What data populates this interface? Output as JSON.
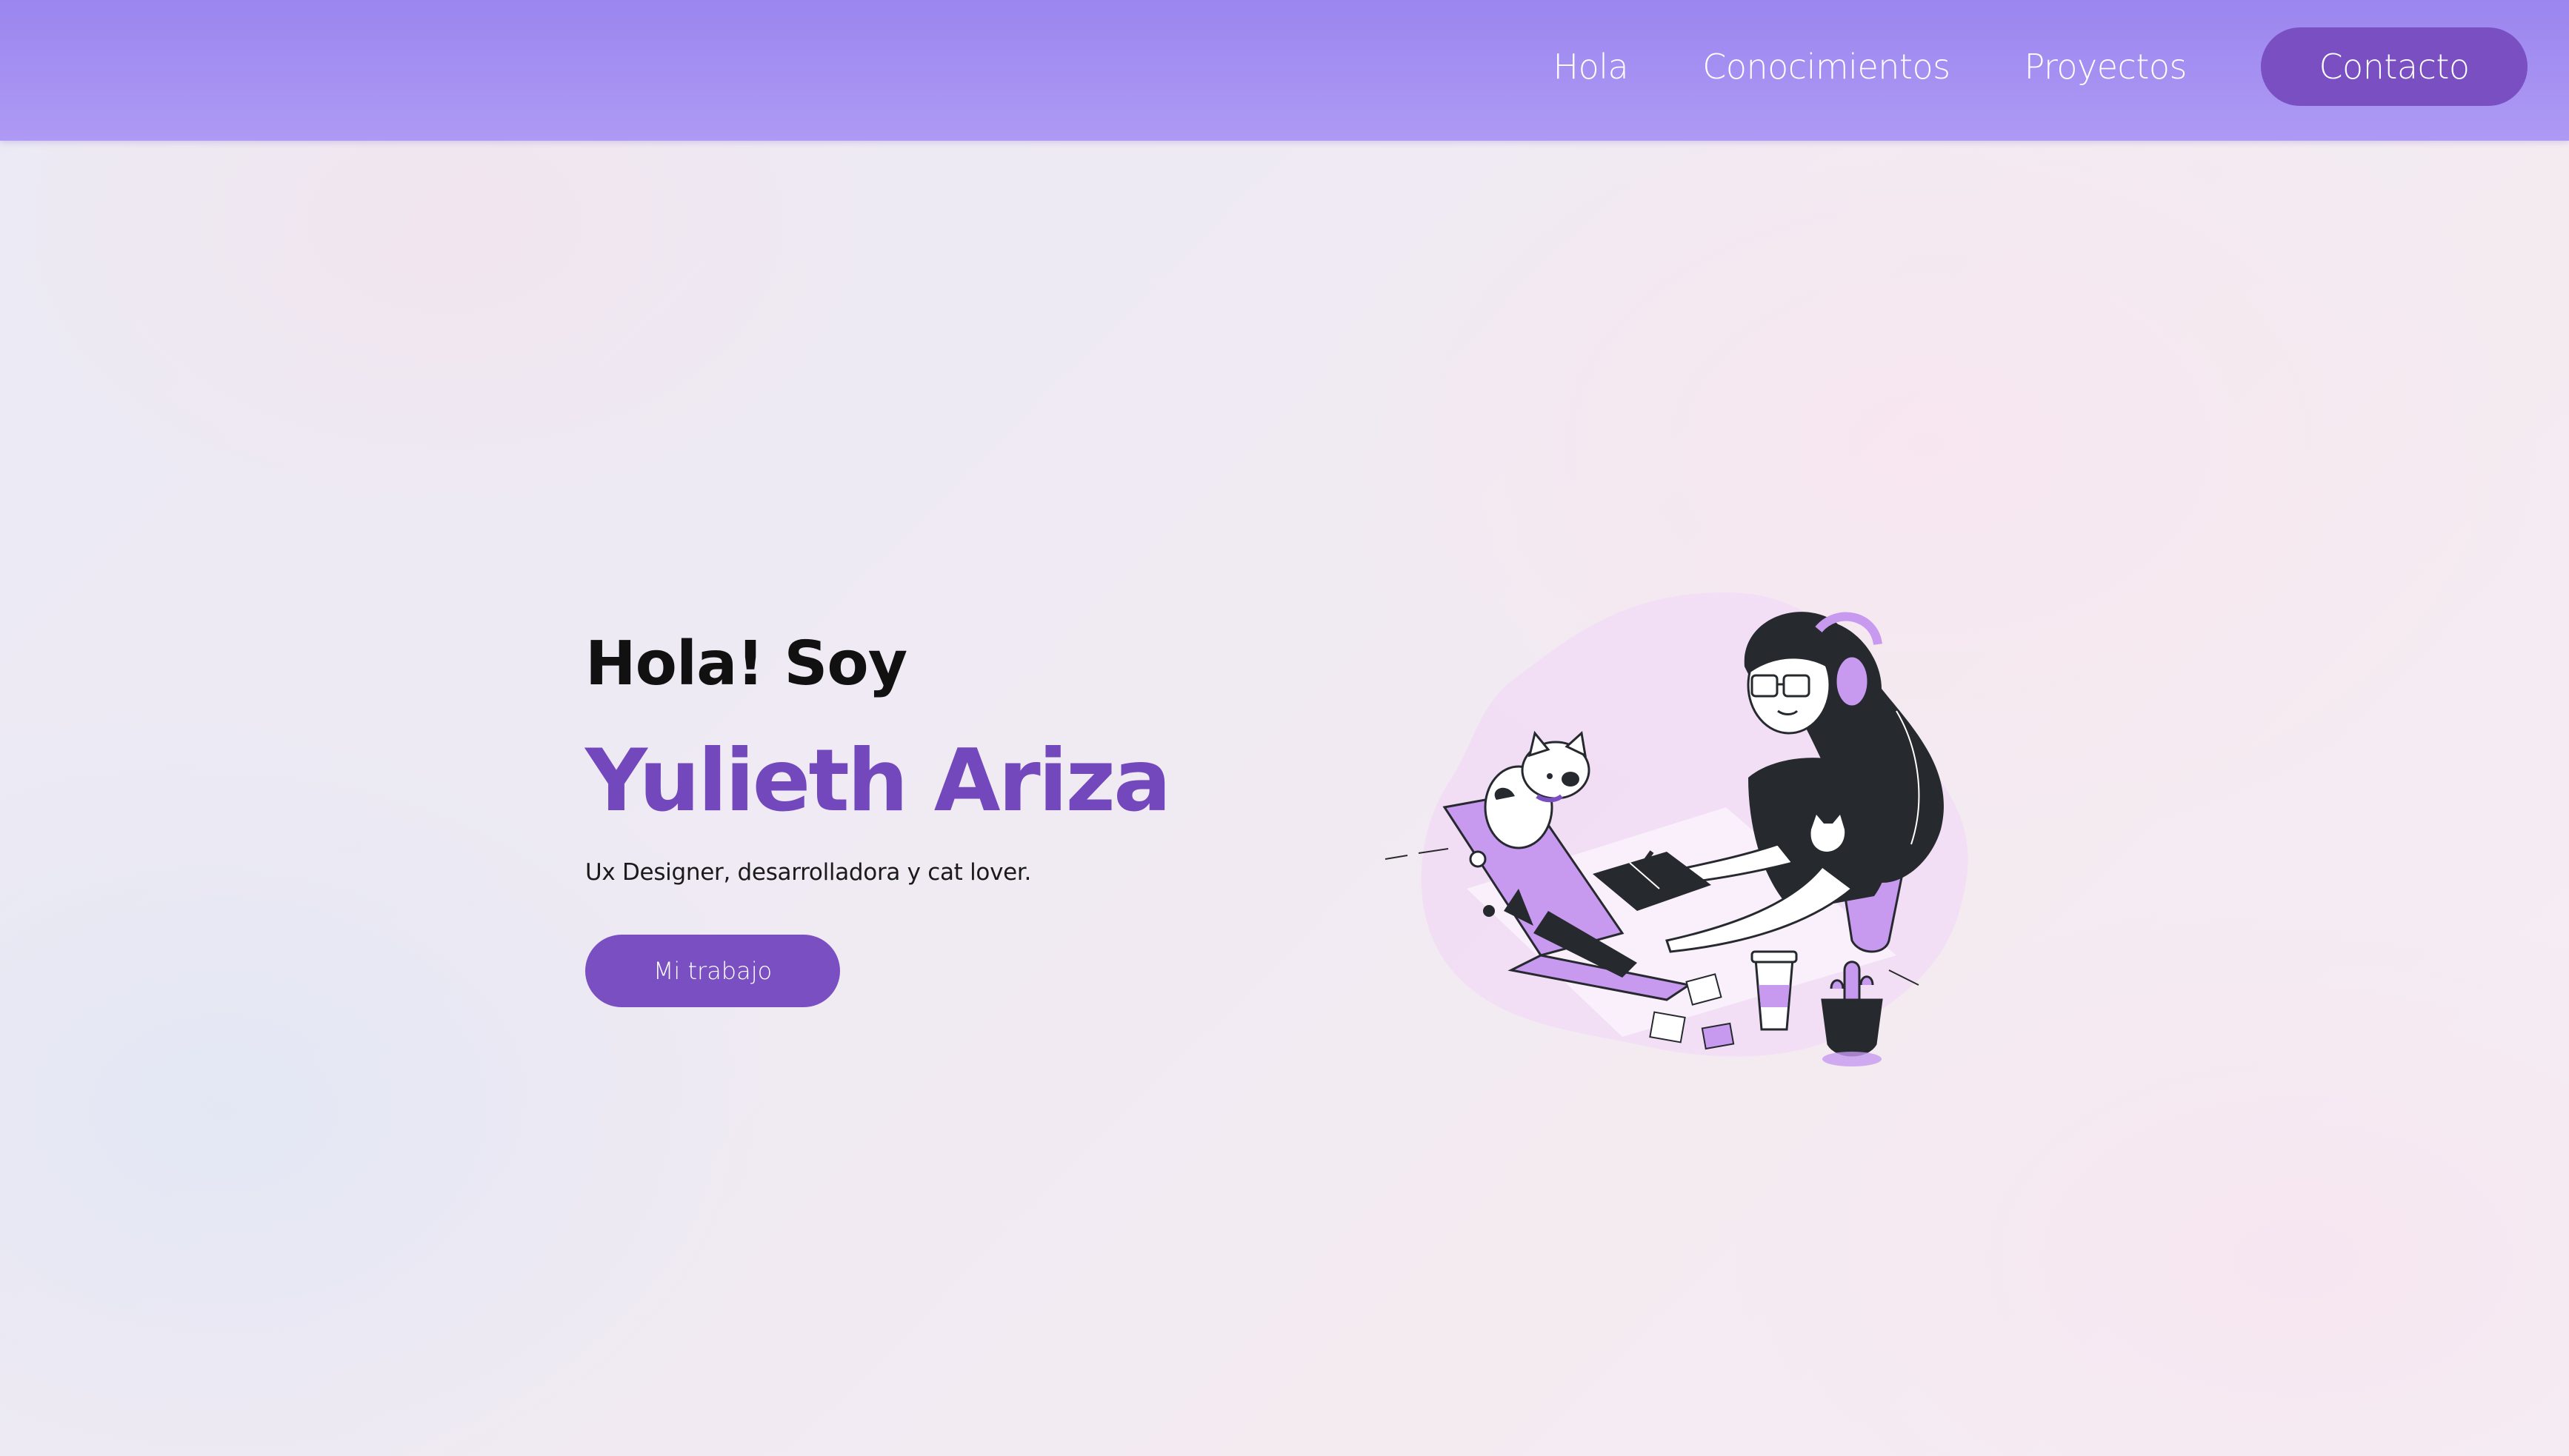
{
  "header": {
    "nav": [
      {
        "label": "Hola"
      },
      {
        "label": "Conocimientos"
      },
      {
        "label": "Proyectos"
      }
    ],
    "cta_label": "Contacto"
  },
  "hero": {
    "greeting": "Hola! Soy",
    "name": "Yulieth Ariza",
    "tagline": "Ux Designer, desarrolladora y cat lover.",
    "button_label": "Mi trabajo"
  },
  "illustration": {
    "icon": "designer-with-cat-at-laptop-illustration"
  },
  "colors": {
    "header": "#a08bf0",
    "accent": "#7a4fc2",
    "name": "#7348bd",
    "illustration_purple": "#c79af0",
    "illustration_dark": "#26292e"
  }
}
